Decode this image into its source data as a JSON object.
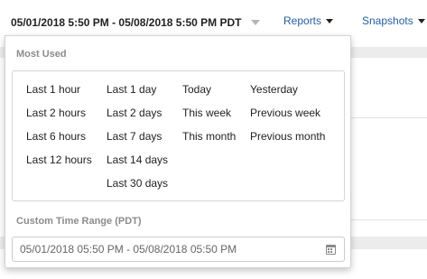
{
  "header": {
    "date_range": "05/01/2018 5:50 PM - 05/08/2018 5:50 PM PDT",
    "nav": [
      {
        "label": "Reports"
      },
      {
        "label": "Snapshots"
      }
    ]
  },
  "dropdown": {
    "most_used_label": "Most Used",
    "columns": [
      [
        "Last 1 hour",
        "Last 2 hours",
        "Last 6 hours",
        "Last 12 hours"
      ],
      [
        "Last 1 day",
        "Last 2 days",
        "Last 7 days",
        "Last 14 days",
        "Last 30 days"
      ],
      [
        "Today",
        "This week",
        "This month"
      ],
      [
        "Yesterday",
        "Previous week",
        "Previous month"
      ]
    ],
    "custom_label": "Custom Time Range (PDT)",
    "custom_value": "05/01/2018 05:50 PM - 05/08/2018 05:50 PM"
  },
  "icons": {
    "toggle_caret": "chevron-down-icon",
    "nav_caret": "caret-down-icon",
    "calendar": "calendar-icon"
  },
  "colors": {
    "link": "#1f5fa8",
    "section_label": "#8c8c8c",
    "border": "#d3d3d3"
  }
}
